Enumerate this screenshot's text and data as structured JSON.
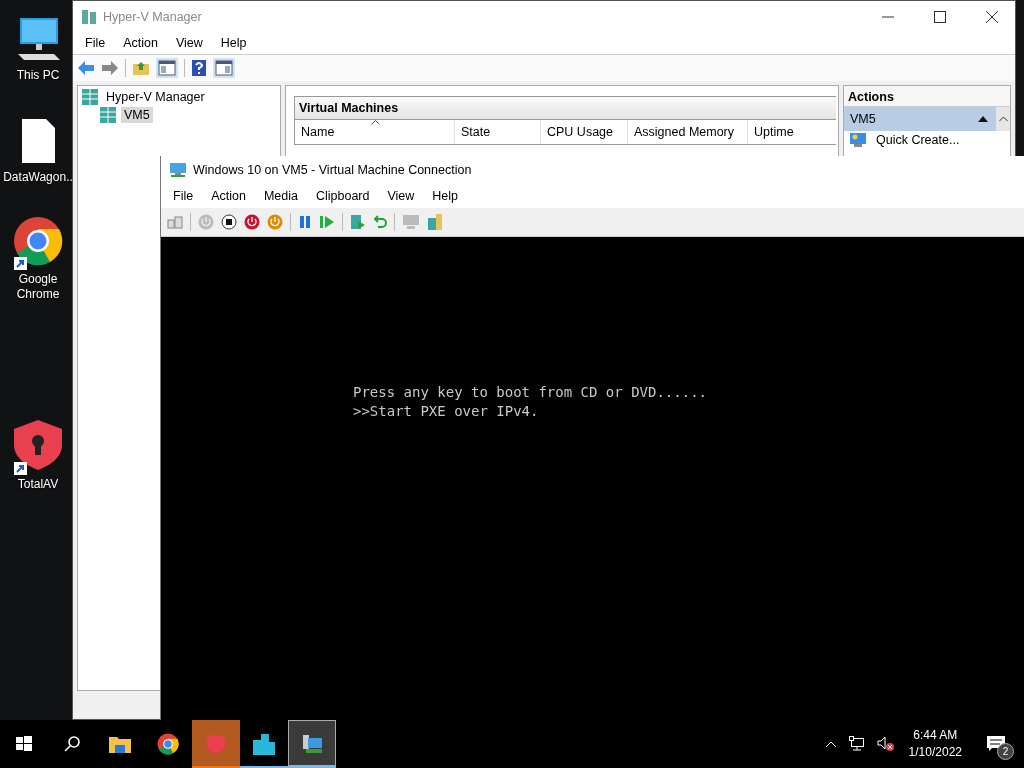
{
  "desktop_icons": [
    {
      "label": "This PC",
      "kind": "computer",
      "shortcut": false
    },
    {
      "label": "DataWagon..",
      "kind": "file",
      "shortcut": false
    },
    {
      "label": "Google Chrome",
      "kind": "chrome",
      "shortcut": true
    },
    {
      "label": "TotalAV",
      "kind": "shield",
      "shortcut": true
    }
  ],
  "hyperv_manager": {
    "title": "Hyper-V Manager",
    "menu": [
      "File",
      "Action",
      "View",
      "Help"
    ],
    "tree": {
      "label": "Hyper-V Manager",
      "selected": false,
      "children": [
        {
          "label": "VM5",
          "selected": true
        }
      ]
    },
    "vm_panel": {
      "title": "Virtual Machines",
      "columns": [
        {
          "label": "Name",
          "sorted": true
        },
        {
          "label": "State",
          "sorted": false
        },
        {
          "label": "CPU Usage",
          "sorted": false
        },
        {
          "label": "Assigned Memory",
          "sorted": false
        },
        {
          "label": "Uptime",
          "sorted": false
        }
      ]
    },
    "actions": {
      "title": "Actions",
      "group": {
        "label": "VM5",
        "expanded": true
      },
      "items": [
        "Quick Create..."
      ]
    }
  },
  "vm_connection": {
    "title": "Windows 10 on VM5 - Virtual Machine Connection",
    "menu": [
      "File",
      "Action",
      "Media",
      "Clipboard",
      "View",
      "Help"
    ],
    "screen_lines": [
      "Press any key to boot from CD or DVD......",
      ">>Start PXE over IPv4."
    ]
  },
  "taskbar": {
    "apps": [
      {
        "kind": "explorer",
        "running": false,
        "active": false,
        "flashing": false
      },
      {
        "kind": "chrome",
        "running": false,
        "active": false,
        "flashing": false
      },
      {
        "kind": "shield",
        "running": false,
        "active": false,
        "flashing": true
      },
      {
        "kind": "hyperv",
        "running": true,
        "active": false,
        "flashing": false
      },
      {
        "kind": "vmconnect",
        "running": true,
        "active": true,
        "flashing": false
      }
    ],
    "time": "6:44 AM",
    "date": "1/10/2022",
    "notification_count": "2"
  }
}
